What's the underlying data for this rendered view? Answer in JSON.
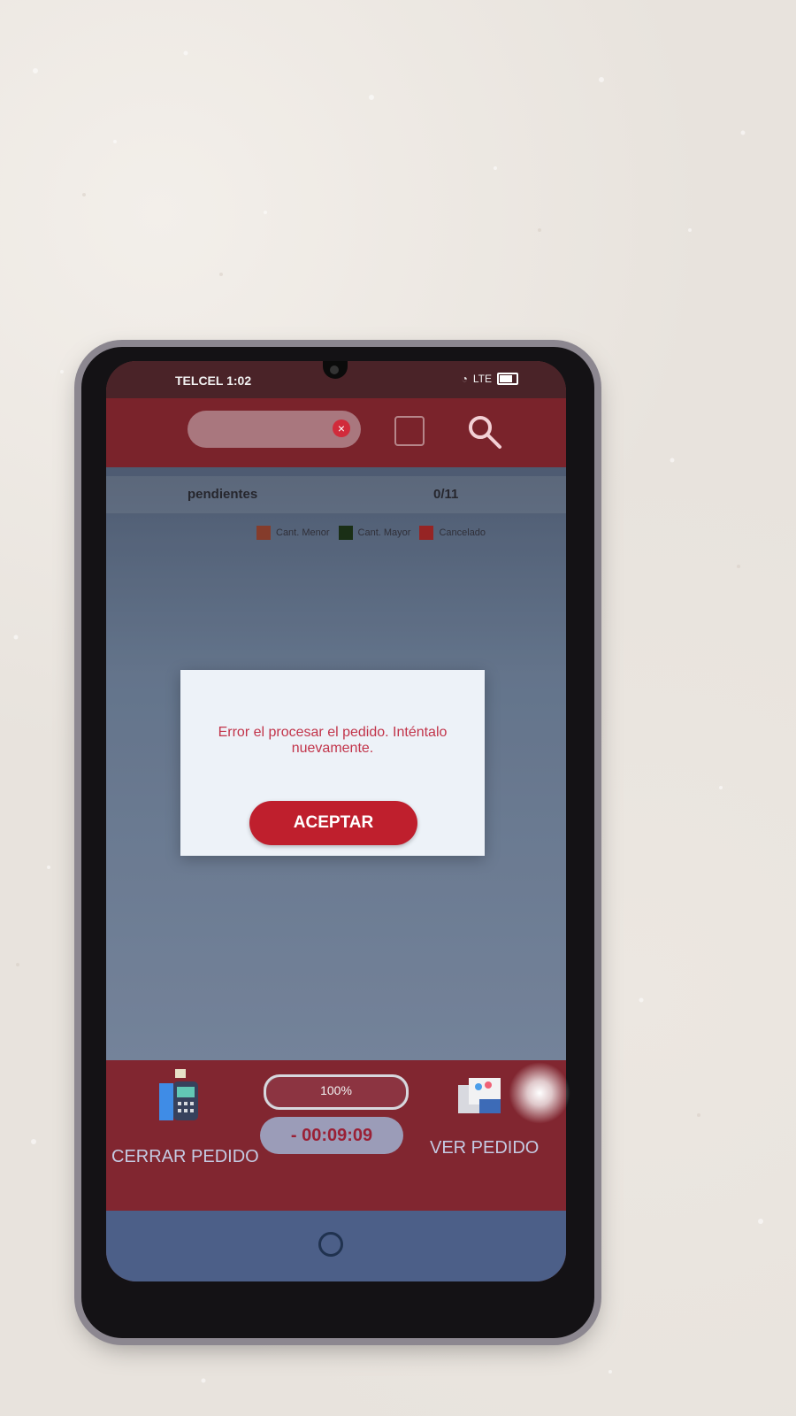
{
  "status_bar": {
    "carrier_time": "TELCEL 1:02",
    "signal_label": "LTE"
  },
  "header": {
    "search_placeholder": "",
    "clear_icon": "close-circle-icon",
    "scan_icon": "scan-frame-icon",
    "search_icon": "search-icon"
  },
  "summary": {
    "label": "pendientes",
    "count": "0/11"
  },
  "legend": {
    "items": [
      {
        "label": "Cant. Menor",
        "color": "#a34a35"
      },
      {
        "label": "Cant. Mayor",
        "color": "#203a1b"
      },
      {
        "label": "Cancelado",
        "color": "#b82d2d"
      }
    ]
  },
  "dialog": {
    "message": "Error el procesar el pedido. Inténtalo nuevamente.",
    "accept_label": "ACEPTAR"
  },
  "bottom_bar": {
    "close_order_label": "CERRAR PEDIDO",
    "progress_text": "100%",
    "progress_fraction": 1.0,
    "timer": "- 00:09:09",
    "view_order_label": "VER PEDIDO"
  },
  "nav": {
    "back_icon": "back-icon",
    "home_icon": "home-icon"
  },
  "colors": {
    "accent_red": "#bf1f2d",
    "header_red": "#7a232b",
    "dialog_bg": "#edf2f8",
    "nav_blue": "#4c5f88"
  }
}
